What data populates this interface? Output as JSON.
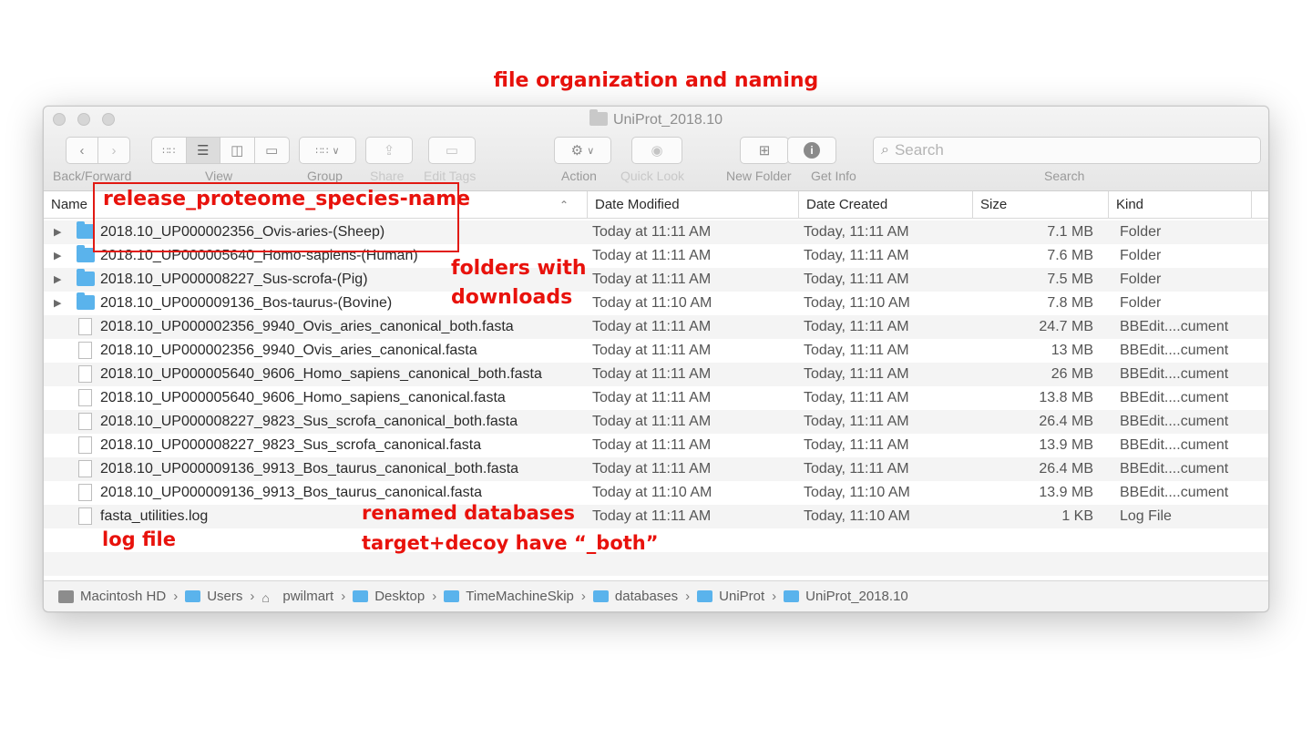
{
  "slide_title": "file organization and naming",
  "window": {
    "title": "UniProt_2018.10",
    "toolbar": {
      "back_forward_label": "Back/Forward",
      "view_label": "View",
      "group_label": "Group",
      "share_label": "Share",
      "edit_tags_label": "Edit Tags",
      "action_label": "Action",
      "quick_look_label": "Quick Look",
      "new_folder_label": "New Folder",
      "get_info_label": "Get Info",
      "search_label": "Search",
      "search_placeholder": "Search"
    },
    "columns": {
      "name": "Name",
      "date_modified": "Date Modified",
      "date_created": "Date Created",
      "size": "Size",
      "kind": "Kind"
    },
    "rows": [
      {
        "type": "folder",
        "name": "2018.10_UP000002356_Ovis-aries-(Sheep)",
        "date_modified": "Today at 11:11 AM",
        "date_created": "Today, 11:11 AM",
        "size": "7.1 MB",
        "kind": "Folder"
      },
      {
        "type": "folder",
        "name": "2018.10_UP000005640_Homo-sapiens-(Human)",
        "date_modified": "Today at 11:11 AM",
        "date_created": "Today, 11:11 AM",
        "size": "7.6 MB",
        "kind": "Folder"
      },
      {
        "type": "folder",
        "name": "2018.10_UP000008227_Sus-scrofa-(Pig)",
        "date_modified": "Today at 11:11 AM",
        "date_created": "Today, 11:11 AM",
        "size": "7.5 MB",
        "kind": "Folder"
      },
      {
        "type": "folder",
        "name": "2018.10_UP000009136_Bos-taurus-(Bovine)",
        "date_modified": "Today at 11:10 AM",
        "date_created": "Today, 11:10 AM",
        "size": "7.8 MB",
        "kind": "Folder"
      },
      {
        "type": "file",
        "name": "2018.10_UP000002356_9940_Ovis_aries_canonical_both.fasta",
        "date_modified": "Today at 11:11 AM",
        "date_created": "Today, 11:11 AM",
        "size": "24.7 MB",
        "kind": "BBEdit....cument"
      },
      {
        "type": "file",
        "name": "2018.10_UP000002356_9940_Ovis_aries_canonical.fasta",
        "date_modified": "Today at 11:11 AM",
        "date_created": "Today, 11:11 AM",
        "size": "13 MB",
        "kind": "BBEdit....cument"
      },
      {
        "type": "file",
        "name": "2018.10_UP000005640_9606_Homo_sapiens_canonical_both.fasta",
        "date_modified": "Today at 11:11 AM",
        "date_created": "Today, 11:11 AM",
        "size": "26 MB",
        "kind": "BBEdit....cument"
      },
      {
        "type": "file",
        "name": "2018.10_UP000005640_9606_Homo_sapiens_canonical.fasta",
        "date_modified": "Today at 11:11 AM",
        "date_created": "Today, 11:11 AM",
        "size": "13.8 MB",
        "kind": "BBEdit....cument"
      },
      {
        "type": "file",
        "name": "2018.10_UP000008227_9823_Sus_scrofa_canonical_both.fasta",
        "date_modified": "Today at 11:11 AM",
        "date_created": "Today, 11:11 AM",
        "size": "26.4 MB",
        "kind": "BBEdit....cument"
      },
      {
        "type": "file",
        "name": "2018.10_UP000008227_9823_Sus_scrofa_canonical.fasta",
        "date_modified": "Today at 11:11 AM",
        "date_created": "Today, 11:11 AM",
        "size": "13.9 MB",
        "kind": "BBEdit....cument"
      },
      {
        "type": "file",
        "name": "2018.10_UP000009136_9913_Bos_taurus_canonical_both.fasta",
        "date_modified": "Today at 11:11 AM",
        "date_created": "Today, 11:11 AM",
        "size": "26.4 MB",
        "kind": "BBEdit....cument"
      },
      {
        "type": "file",
        "name": "2018.10_UP000009136_9913_Bos_taurus_canonical.fasta",
        "date_modified": "Today at 11:10 AM",
        "date_created": "Today, 11:10 AM",
        "size": "13.9 MB",
        "kind": "BBEdit....cument"
      },
      {
        "type": "file",
        "name": "fasta_utilities.log",
        "date_modified": "Today at 11:11 AM",
        "date_created": "Today, 11:10 AM",
        "size": "1 KB",
        "kind": "Log File"
      }
    ],
    "path_bar": [
      {
        "label": "Macintosh HD",
        "icon": "hard-drive-icon"
      },
      {
        "label": "Users",
        "icon": "folder-icon"
      },
      {
        "label": "pwilmart",
        "icon": "home-icon"
      },
      {
        "label": "Desktop",
        "icon": "folder-icon"
      },
      {
        "label": "TimeMachineSkip",
        "icon": "folder-icon"
      },
      {
        "label": "databases",
        "icon": "folder-icon"
      },
      {
        "label": "UniProt",
        "icon": "folder-icon"
      },
      {
        "label": "UniProt_2018.10",
        "icon": "folder-icon"
      }
    ]
  },
  "annotations": {
    "naming": "release_proteome_species-name",
    "folders_line1": "folders with",
    "folders_line2": "downloads",
    "renamed_line1": "renamed databases",
    "renamed_line2": "target+decoy have “_both”",
    "log_file": "log file"
  },
  "colors": {
    "annotation_red": "#e8120c",
    "folder_blue": "#5ab3ec"
  }
}
